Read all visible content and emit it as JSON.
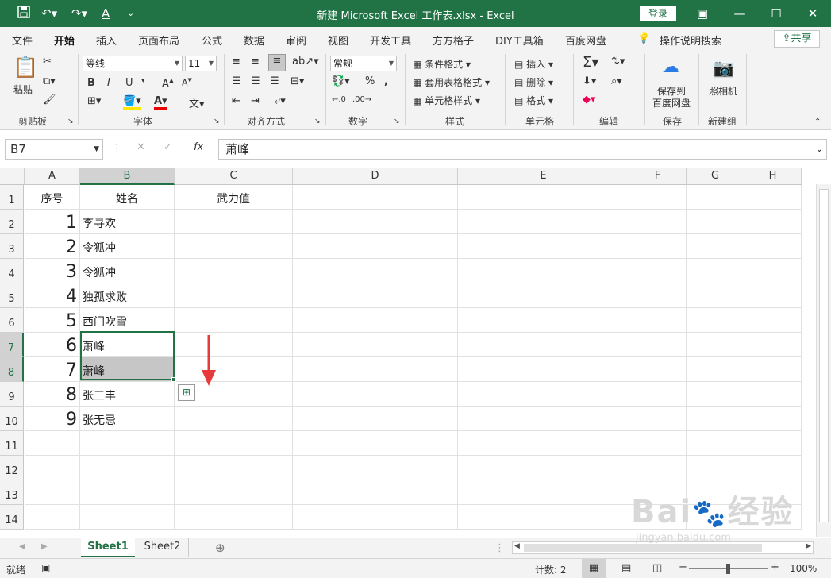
{
  "title_bar": {
    "title": "新建 Microsoft Excel 工作表.xlsx  -  Excel",
    "login": "登录"
  },
  "quick_access": {
    "save_icon": "save-icon",
    "undo_icon": "undo-icon",
    "redo_icon": "redo-icon",
    "font_color_icon": "A"
  },
  "menu_tabs": [
    "文件",
    "开始",
    "插入",
    "页面布局",
    "公式",
    "数据",
    "审阅",
    "视图",
    "开发工具",
    "方方格子",
    "DIY工具箱",
    "百度网盘"
  ],
  "tell_me": "操作说明搜索",
  "share": "共享",
  "ribbon": {
    "clipboard": {
      "paste": "粘贴",
      "label": "剪贴板"
    },
    "font": {
      "name": "等线",
      "size": "11",
      "label": "字体",
      "bold": "B",
      "italic": "I",
      "underline": "U"
    },
    "alignment": {
      "label": "对齐方式"
    },
    "number": {
      "format": "常规",
      "label": "数字",
      "percent": "%"
    },
    "styles": {
      "conditional": "条件格式",
      "table": "套用表格格式",
      "cell": "单元格样式",
      "label": "样式"
    },
    "cells": {
      "insert": "插入",
      "delete": "删除",
      "format": "格式",
      "label": "单元格"
    },
    "editing": {
      "label": "编辑"
    },
    "save": {
      "line1": "保存到",
      "line2": "百度网盘",
      "label": "保存"
    },
    "camera": {
      "text": "照相机",
      "label": "新建组"
    }
  },
  "formula_bar": {
    "name_box": "B7",
    "fx": "fx",
    "content": "萧峰"
  },
  "columns": [
    "A",
    "B",
    "C",
    "D",
    "E",
    "F",
    "G",
    "H"
  ],
  "rows": [
    {
      "n": "1",
      "a": "序号",
      "b": "姓名",
      "c": "武力值"
    },
    {
      "n": "2",
      "a": "1",
      "b": "李寻欢",
      "c": ""
    },
    {
      "n": "3",
      "a": "2",
      "b": "令狐冲",
      "c": ""
    },
    {
      "n": "4",
      "a": "3",
      "b": "令狐冲",
      "c": ""
    },
    {
      "n": "5",
      "a": "4",
      "b": "独孤求败",
      "c": ""
    },
    {
      "n": "6",
      "a": "5",
      "b": "西门吹雪",
      "c": ""
    },
    {
      "n": "7",
      "a": "6",
      "b": "萧峰",
      "c": ""
    },
    {
      "n": "8",
      "a": "7",
      "b": "萧峰",
      "c": ""
    },
    {
      "n": "9",
      "a": "8",
      "b": "张三丰",
      "c": ""
    },
    {
      "n": "10",
      "a": "9",
      "b": "张无忌",
      "c": ""
    },
    {
      "n": "11",
      "a": "",
      "b": "",
      "c": ""
    },
    {
      "n": "12",
      "a": "",
      "b": "",
      "c": ""
    },
    {
      "n": "13",
      "a": "",
      "b": "",
      "c": ""
    },
    {
      "n": "14",
      "a": "",
      "b": "",
      "c": ""
    }
  ],
  "sheets": [
    "Sheet1",
    "Sheet2"
  ],
  "status": {
    "ready": "就绪",
    "count": "计数: 2",
    "zoom": "100%"
  },
  "colors": {
    "accent": "#217346",
    "arrow": "#e83a3a"
  },
  "watermark": {
    "line1": "Bai 经验",
    "line2": "jingyan.baidu.com"
  }
}
